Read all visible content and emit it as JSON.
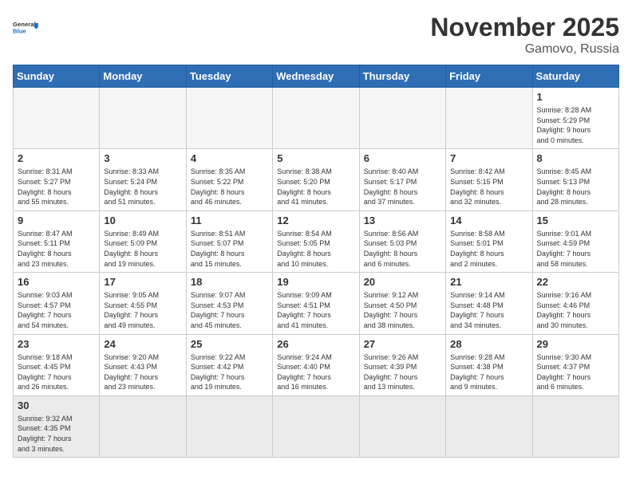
{
  "header": {
    "logo_general": "General",
    "logo_blue": "Blue",
    "month": "November 2025",
    "location": "Gamovo, Russia"
  },
  "weekdays": [
    "Sunday",
    "Monday",
    "Tuesday",
    "Wednesday",
    "Thursday",
    "Friday",
    "Saturday"
  ],
  "weeks": [
    [
      {
        "day": "",
        "info": ""
      },
      {
        "day": "",
        "info": ""
      },
      {
        "day": "",
        "info": ""
      },
      {
        "day": "",
        "info": ""
      },
      {
        "day": "",
        "info": ""
      },
      {
        "day": "",
        "info": ""
      },
      {
        "day": "1",
        "info": "Sunrise: 8:28 AM\nSunset: 5:29 PM\nDaylight: 9 hours\nand 0 minutes."
      }
    ],
    [
      {
        "day": "2",
        "info": "Sunrise: 8:31 AM\nSunset: 5:27 PM\nDaylight: 8 hours\nand 55 minutes."
      },
      {
        "day": "3",
        "info": "Sunrise: 8:33 AM\nSunset: 5:24 PM\nDaylight: 8 hours\nand 51 minutes."
      },
      {
        "day": "4",
        "info": "Sunrise: 8:35 AM\nSunset: 5:22 PM\nDaylight: 8 hours\nand 46 minutes."
      },
      {
        "day": "5",
        "info": "Sunrise: 8:38 AM\nSunset: 5:20 PM\nDaylight: 8 hours\nand 41 minutes."
      },
      {
        "day": "6",
        "info": "Sunrise: 8:40 AM\nSunset: 5:17 PM\nDaylight: 8 hours\nand 37 minutes."
      },
      {
        "day": "7",
        "info": "Sunrise: 8:42 AM\nSunset: 5:15 PM\nDaylight: 8 hours\nand 32 minutes."
      },
      {
        "day": "8",
        "info": "Sunrise: 8:45 AM\nSunset: 5:13 PM\nDaylight: 8 hours\nand 28 minutes."
      }
    ],
    [
      {
        "day": "9",
        "info": "Sunrise: 8:47 AM\nSunset: 5:11 PM\nDaylight: 8 hours\nand 23 minutes."
      },
      {
        "day": "10",
        "info": "Sunrise: 8:49 AM\nSunset: 5:09 PM\nDaylight: 8 hours\nand 19 minutes."
      },
      {
        "day": "11",
        "info": "Sunrise: 8:51 AM\nSunset: 5:07 PM\nDaylight: 8 hours\nand 15 minutes."
      },
      {
        "day": "12",
        "info": "Sunrise: 8:54 AM\nSunset: 5:05 PM\nDaylight: 8 hours\nand 10 minutes."
      },
      {
        "day": "13",
        "info": "Sunrise: 8:56 AM\nSunset: 5:03 PM\nDaylight: 8 hours\nand 6 minutes."
      },
      {
        "day": "14",
        "info": "Sunrise: 8:58 AM\nSunset: 5:01 PM\nDaylight: 8 hours\nand 2 minutes."
      },
      {
        "day": "15",
        "info": "Sunrise: 9:01 AM\nSunset: 4:59 PM\nDaylight: 7 hours\nand 58 minutes."
      }
    ],
    [
      {
        "day": "16",
        "info": "Sunrise: 9:03 AM\nSunset: 4:57 PM\nDaylight: 7 hours\nand 54 minutes."
      },
      {
        "day": "17",
        "info": "Sunrise: 9:05 AM\nSunset: 4:55 PM\nDaylight: 7 hours\nand 49 minutes."
      },
      {
        "day": "18",
        "info": "Sunrise: 9:07 AM\nSunset: 4:53 PM\nDaylight: 7 hours\nand 45 minutes."
      },
      {
        "day": "19",
        "info": "Sunrise: 9:09 AM\nSunset: 4:51 PM\nDaylight: 7 hours\nand 41 minutes."
      },
      {
        "day": "20",
        "info": "Sunrise: 9:12 AM\nSunset: 4:50 PM\nDaylight: 7 hours\nand 38 minutes."
      },
      {
        "day": "21",
        "info": "Sunrise: 9:14 AM\nSunset: 4:48 PM\nDaylight: 7 hours\nand 34 minutes."
      },
      {
        "day": "22",
        "info": "Sunrise: 9:16 AM\nSunset: 4:46 PM\nDaylight: 7 hours\nand 30 minutes."
      }
    ],
    [
      {
        "day": "23",
        "info": "Sunrise: 9:18 AM\nSunset: 4:45 PM\nDaylight: 7 hours\nand 26 minutes."
      },
      {
        "day": "24",
        "info": "Sunrise: 9:20 AM\nSunset: 4:43 PM\nDaylight: 7 hours\nand 23 minutes."
      },
      {
        "day": "25",
        "info": "Sunrise: 9:22 AM\nSunset: 4:42 PM\nDaylight: 7 hours\nand 19 minutes."
      },
      {
        "day": "26",
        "info": "Sunrise: 9:24 AM\nSunset: 4:40 PM\nDaylight: 7 hours\nand 16 minutes."
      },
      {
        "day": "27",
        "info": "Sunrise: 9:26 AM\nSunset: 4:39 PM\nDaylight: 7 hours\nand 13 minutes."
      },
      {
        "day": "28",
        "info": "Sunrise: 9:28 AM\nSunset: 4:38 PM\nDaylight: 7 hours\nand 9 minutes."
      },
      {
        "day": "29",
        "info": "Sunrise: 9:30 AM\nSunset: 4:37 PM\nDaylight: 7 hours\nand 6 minutes."
      }
    ],
    [
      {
        "day": "30",
        "info": "Sunrise: 9:32 AM\nSunset: 4:35 PM\nDaylight: 7 hours\nand 3 minutes."
      },
      {
        "day": "",
        "info": ""
      },
      {
        "day": "",
        "info": ""
      },
      {
        "day": "",
        "info": ""
      },
      {
        "day": "",
        "info": ""
      },
      {
        "day": "",
        "info": ""
      },
      {
        "day": "",
        "info": ""
      }
    ]
  ]
}
